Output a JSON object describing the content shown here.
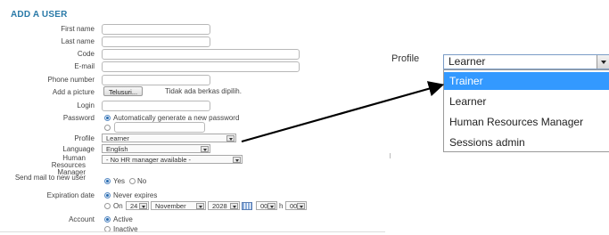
{
  "form": {
    "title": "ADD A USER",
    "labels": {
      "first_name": "First name",
      "last_name": "Last name",
      "code": "Code",
      "email": "E-mail",
      "phone": "Phone number",
      "picture": "Add a picture",
      "login": "Login",
      "password": "Password",
      "profile": "Profile",
      "language": "Language",
      "hr_manager": "Human Resources Manager",
      "send_mail": "Send mail to new user",
      "expiration": "Expiration date",
      "account": "Account"
    },
    "picture_button": "Telusuri...",
    "picture_status": "Tidak ada berkas dipilih.",
    "password_auto": "Automatically generate a new password",
    "profile_value": "Learner",
    "language_value": "English",
    "hr_value": "- No HR manager available -",
    "send_yes": "Yes",
    "send_no": "No",
    "never_expires": "Never expires",
    "on_label": "On",
    "exp_day": "24",
    "exp_month": "November",
    "exp_year": "2028",
    "exp_hour": "00",
    "h_label": "h",
    "exp_minute": "00",
    "account_active": "Active",
    "account_inactive": "Inactive"
  },
  "zoom": {
    "label": "Profile",
    "selected": "Learner",
    "options": [
      "Trainer",
      "Learner",
      "Human Resources Manager",
      "Sessions admin"
    ],
    "highlighted_index": 0,
    "highlight_color": "#3399ff"
  },
  "colors": {
    "title": "#2a7aa8",
    "arrow": "#000000"
  }
}
